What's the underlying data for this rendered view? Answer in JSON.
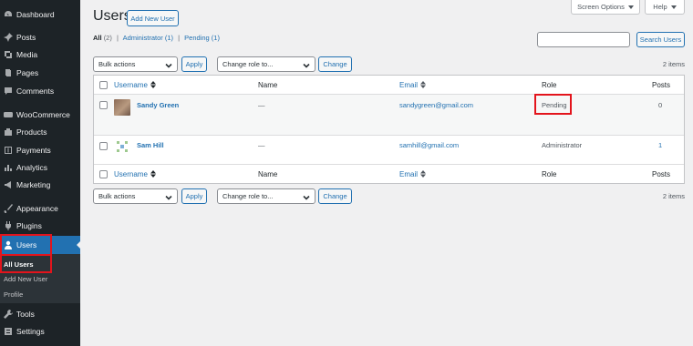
{
  "sidebar": {
    "items": [
      {
        "label": "Dashboard",
        "icon": "dashboard-icon"
      },
      {
        "label": "Posts",
        "icon": "pin-icon"
      },
      {
        "label": "Media",
        "icon": "media-icon"
      },
      {
        "label": "Pages",
        "icon": "pages-icon"
      },
      {
        "label": "Comments",
        "icon": "comments-icon"
      },
      {
        "label": "WooCommerce",
        "icon": "woocommerce-icon"
      },
      {
        "label": "Products",
        "icon": "products-icon"
      },
      {
        "label": "Payments",
        "icon": "payments-icon"
      },
      {
        "label": "Analytics",
        "icon": "analytics-icon"
      },
      {
        "label": "Marketing",
        "icon": "marketing-icon"
      },
      {
        "label": "Appearance",
        "icon": "appearance-icon"
      },
      {
        "label": "Plugins",
        "icon": "plugins-icon"
      },
      {
        "label": "Users",
        "icon": "users-icon"
      },
      {
        "label": "Tools",
        "icon": "tools-icon"
      },
      {
        "label": "Settings",
        "icon": "settings-icon"
      }
    ],
    "submenu": [
      "All Users",
      "Add New User",
      "Profile"
    ]
  },
  "header": {
    "title": "Users",
    "add_new": "Add New User",
    "screen_options": "Screen Options",
    "help": "Help"
  },
  "filters": {
    "all": "All",
    "all_count": "(2)",
    "administrator": "Administrator",
    "administrator_count": "(1)",
    "pending": "Pending",
    "pending_count": "(1)",
    "separator": "|"
  },
  "search": {
    "button": "Search Users",
    "value": ""
  },
  "bulk": {
    "actions_label": "Bulk actions",
    "apply": "Apply",
    "role_label": "Change role to...",
    "change": "Change",
    "items_count": "2 items"
  },
  "table": {
    "columns": [
      "Username",
      "Name",
      "Email",
      "Role",
      "Posts"
    ],
    "rows": [
      {
        "username": "Sandy Green",
        "name": "—",
        "email": "sandygreen@gmail.com",
        "role": "Pending",
        "posts": "0"
      },
      {
        "username": "Sam Hill",
        "name": "—",
        "email": "samhill@gmail.com",
        "role": "Administrator",
        "posts": "1"
      }
    ]
  },
  "colors": {
    "sidebar_bg": "#1d2327",
    "accent": "#2271b1",
    "highlight_box": "#e3141c"
  }
}
